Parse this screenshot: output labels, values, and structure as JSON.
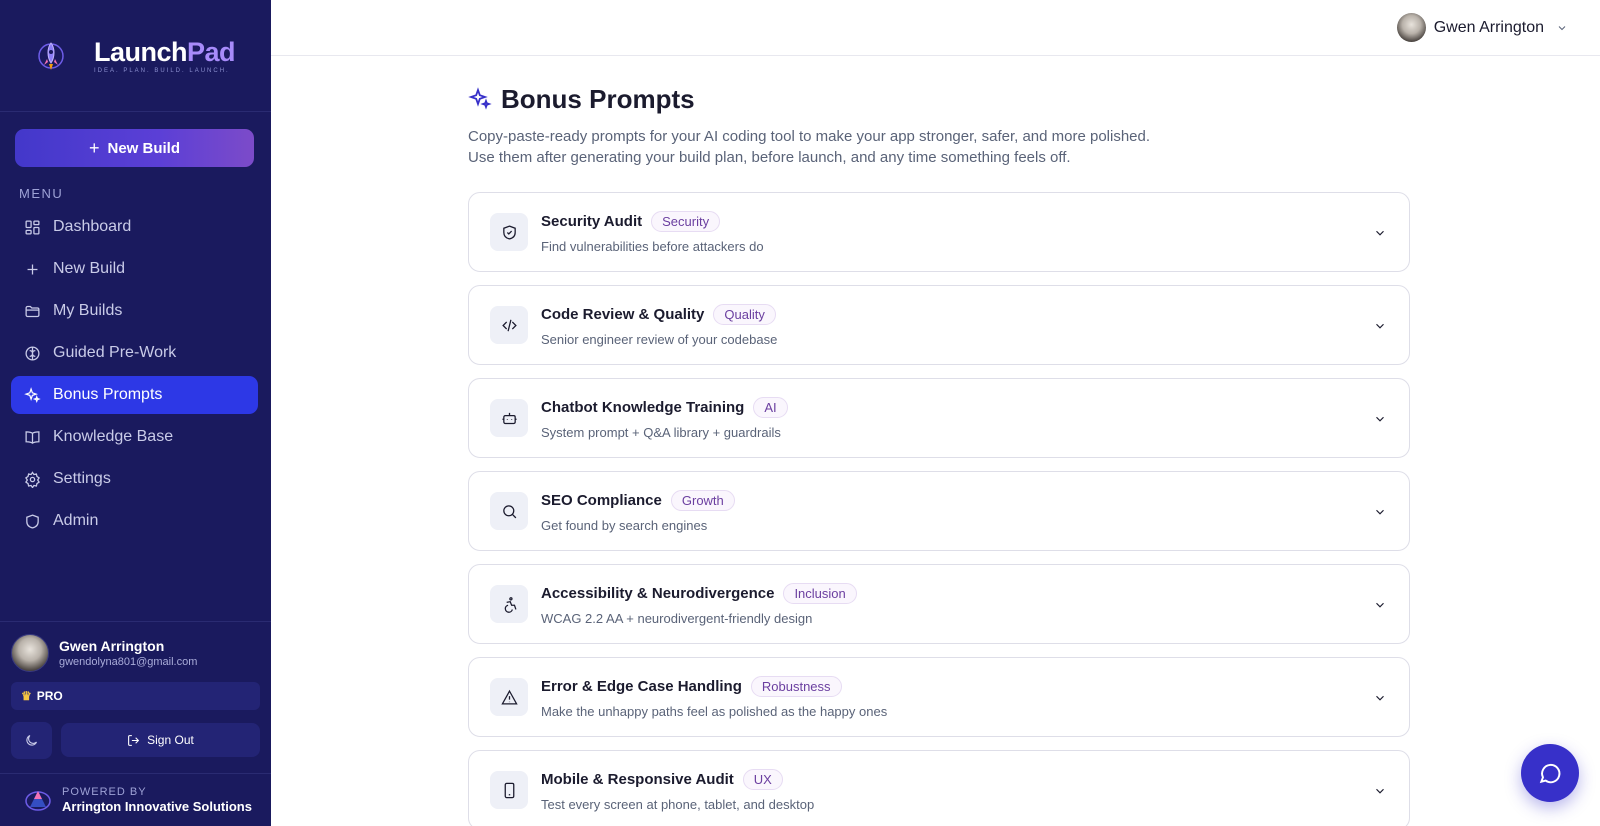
{
  "brand": {
    "name_part1": "Launch",
    "name_part2": "Pad",
    "tagline": "IDEA. PLAN. BUILD. LAUNCH."
  },
  "sidebar": {
    "new_build_label": "New Build",
    "menu_label": "MENU",
    "items": [
      {
        "label": "Dashboard",
        "icon": "dashboard-icon",
        "active": false
      },
      {
        "label": "New Build",
        "icon": "plus-icon",
        "active": false
      },
      {
        "label": "My Builds",
        "icon": "folder-icon",
        "active": false
      },
      {
        "label": "Guided Pre-Work",
        "icon": "brain-icon",
        "active": false
      },
      {
        "label": "Bonus Prompts",
        "icon": "sparkles-icon",
        "active": true
      },
      {
        "label": "Knowledge Base",
        "icon": "book-icon",
        "active": false
      },
      {
        "label": "Settings",
        "icon": "gear-icon",
        "active": false
      },
      {
        "label": "Admin",
        "icon": "shield-icon",
        "active": false
      }
    ],
    "user": {
      "name": "Gwen Arrington",
      "email": "gwendolyna801@gmail.com"
    },
    "plan_badge": "PRO",
    "sign_out_label": "Sign Out",
    "powered_by_label": "POWERED BY",
    "powered_by_name": "Arrington Innovative Solutions"
  },
  "topbar": {
    "user_name": "Gwen Arrington"
  },
  "main": {
    "title": "Bonus Prompts",
    "description": "Copy-paste-ready prompts for your AI coding tool to make your app stronger, safer, and more polished. Use them after generating your build plan, before launch, and any time something feels off.",
    "prompts": [
      {
        "title": "Security Audit",
        "tag": "Security",
        "subtitle": "Find vulnerabilities before attackers do",
        "icon": "shield-check-icon"
      },
      {
        "title": "Code Review & Quality",
        "tag": "Quality",
        "subtitle": "Senior engineer review of your codebase",
        "icon": "code-icon"
      },
      {
        "title": "Chatbot Knowledge Training",
        "tag": "AI",
        "subtitle": "System prompt + Q&A library + guardrails",
        "icon": "bot-icon"
      },
      {
        "title": "SEO Compliance",
        "tag": "Growth",
        "subtitle": "Get found by search engines",
        "icon": "search-icon"
      },
      {
        "title": "Accessibility & Neurodivergence",
        "tag": "Inclusion",
        "subtitle": "WCAG 2.2 AA + neurodivergent-friendly design",
        "icon": "accessibility-icon"
      },
      {
        "title": "Error & Edge Case Handling",
        "tag": "Robustness",
        "subtitle": "Make the unhappy paths feel as polished as the happy ones",
        "icon": "warning-icon"
      },
      {
        "title": "Mobile & Responsive Audit",
        "tag": "UX",
        "subtitle": "Test every screen at phone, tablet, and desktop",
        "icon": "smartphone-icon"
      }
    ]
  },
  "colors": {
    "sidebar_bg": "#1a1a5e",
    "active_nav": "#2d38e6",
    "accent": "#4338ca",
    "tag_text": "#6b3fa0"
  }
}
